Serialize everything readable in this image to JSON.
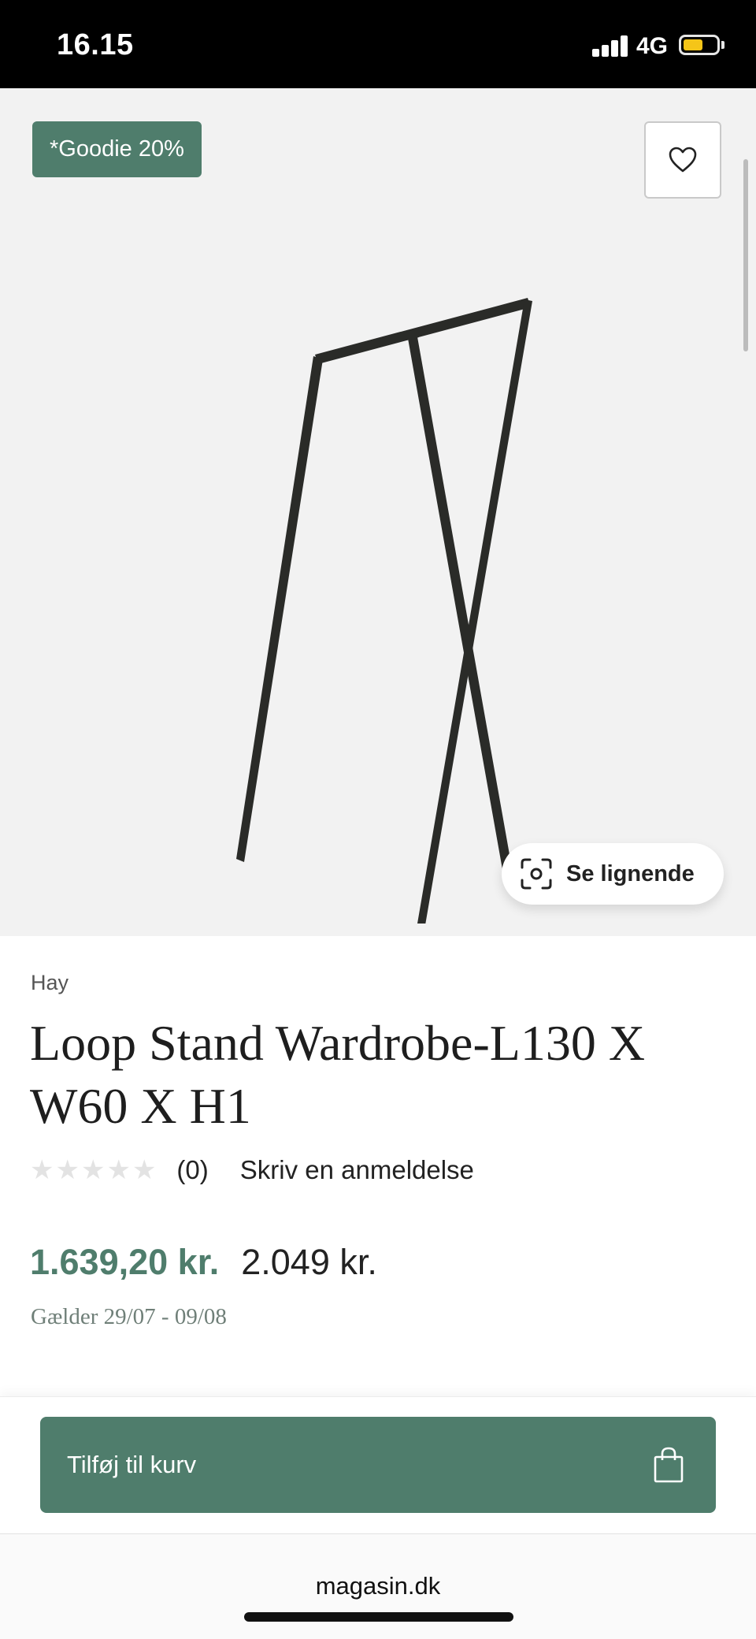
{
  "status_bar": {
    "time": "16.15",
    "network": "4G"
  },
  "badge": {
    "label": "*Goodie 20%"
  },
  "hero": {
    "similar_label": "Se lignende"
  },
  "product": {
    "brand": "Hay",
    "title": "Loop Stand Wardrobe-L130 X W60 X H1",
    "rating": 0,
    "review_count": "(0)",
    "write_review": "Skriv en anmeldelse",
    "sale_price": "1.639,20 kr.",
    "original_price": "2.049 kr.",
    "valid_period": "Gælder 29/07 - 09/08"
  },
  "cart": {
    "label": "Tilføj til kurv"
  },
  "browser": {
    "url": "magasin.dk"
  },
  "colors": {
    "accent": "#4f7d6c",
    "hero_bg": "#f2f2f2",
    "battery": "#f5c518"
  }
}
